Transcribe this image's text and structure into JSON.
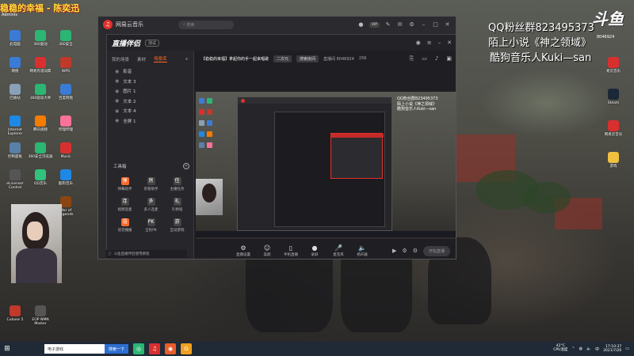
{
  "overlay": {
    "top_left_banner": "稳稳的幸福 - 陈奕迅",
    "admin_label": "Adminis",
    "qq_group": "QQ粉丝群823495373",
    "novel": "陌上小说《神之领域》",
    "kugou_artist": "酷狗音乐人Kuki—san",
    "room_no": "8046924",
    "douyu_logo": "斗鱼"
  },
  "desktop_icons_left": [
    {
      "label": "此电脑",
      "icon": "computer-icon",
      "color": "#3a7bd5"
    },
    {
      "label": "360驱动",
      "icon": "driver-icon",
      "color": "#2bb673"
    },
    {
      "label": "360安全",
      "icon": "shield-icon",
      "color": "#2bb673"
    },
    {
      "label": "网络",
      "icon": "network-icon",
      "color": "#3a7bd5"
    },
    {
      "label": "网易有道词典",
      "icon": "dictionary-icon",
      "color": "#d8302f"
    },
    {
      "label": "WPS",
      "icon": "wps-icon",
      "color": "#c0392b"
    },
    {
      "label": "回收站",
      "icon": "recycle-icon",
      "color": "#8aa0b8"
    },
    {
      "label": "360驱动大师",
      "icon": "driver-master-icon",
      "color": "#2bb673"
    },
    {
      "label": "百度网盘",
      "icon": "cloud-icon",
      "color": "#3a7bd5"
    },
    {
      "label": "Internet Explorer",
      "icon": "ie-icon",
      "color": "#1e88e5"
    },
    {
      "label": "腾讯视频",
      "icon": "video-icon",
      "color": "#f57c00"
    },
    {
      "label": "哔哩哔哩",
      "icon": "bilibili-icon",
      "color": "#fb7299"
    },
    {
      "label": "控制面板",
      "icon": "control-panel-icon",
      "color": "#5a7fa8"
    },
    {
      "label": "360安全浏览器",
      "icon": "browser-icon",
      "color": "#2bb673"
    },
    {
      "label": "Music",
      "icon": "music-icon",
      "color": "#d8302f"
    },
    {
      "label": "eLicenser Control",
      "icon": "elicenser-icon",
      "color": "#555"
    },
    {
      "label": "QQ音乐",
      "icon": "qq-music-icon",
      "color": "#31c27c"
    },
    {
      "label": "酷狗音乐",
      "icon": "kugou-icon",
      "color": "#1e88e5"
    },
    {
      "label": "War of Legends",
      "icon": "game-icon",
      "color": "#8b4513"
    },
    {
      "label": "Cubase 5",
      "icon": "cubase-icon",
      "color": "#c0392b"
    },
    {
      "label": "EOP NMN Master",
      "icon": "eop-icon",
      "color": "#555"
    }
  ],
  "desktop_icons_right": [
    {
      "label": "易云音乐",
      "icon": "netease-music-icon",
      "color": "#d8302f"
    },
    {
      "label": "Steam",
      "icon": "steam-icon",
      "color": "#1b2838"
    },
    {
      "label": "网易云音乐",
      "icon": "netease-icon",
      "color": "#d8302f"
    },
    {
      "label": "游戏",
      "icon": "game-folder-icon",
      "color": "#f0c040"
    }
  ],
  "app": {
    "title": "网易云音乐",
    "search_placeholder": "搜索",
    "user_badge": "VIP",
    "tool": {
      "brand": "直播伴侣",
      "version": "测试",
      "tabs": [
        "我的场景",
        "素材",
        "场景库"
      ],
      "add_tab": "+",
      "scenes": [
        "影音",
        "文本 3",
        "图片 1",
        "文本 2",
        "文本 4",
        "全屏 1"
      ],
      "tools_title": "工具箱",
      "tools": [
        {
          "label": "弹幕助手",
          "glyph": "弹",
          "orange": true
        },
        {
          "label": "房管助手",
          "glyph": "房",
          "orange": false
        },
        {
          "label": "主播任务",
          "glyph": "任",
          "orange": false
        },
        {
          "label": "视频连麦",
          "glyph": "连",
          "orange": false
        },
        {
          "label": "多人连麦",
          "glyph": "多",
          "orange": false
        },
        {
          "label": "礼物墙",
          "glyph": "礼",
          "orange": false
        },
        {
          "label": "语音播报",
          "glyph": "语",
          "orange": true
        },
        {
          "label": "全民PK",
          "glyph": "PK",
          "orange": false
        },
        {
          "label": "互动游戏",
          "glyph": "游",
          "orange": false
        }
      ],
      "footer": "斗鱼直播伴侣使用教程",
      "room_title": "【稳稳的幸福】拿起你的手一起来唱歌",
      "room_category": "二次元",
      "room_chip": "搜索房间",
      "room_stats": "直播间 8046924",
      "room_count": "256",
      "preview_lines": [
        "QQ粉丝群823495373",
        "陌上小说《神之领域》",
        "酷狗音乐人Kuki—san"
      ],
      "controls": [
        {
          "label": "直播设置",
          "icon": "settings-icon",
          "glyph": "⚙"
        },
        {
          "label": "美颜",
          "icon": "beauty-icon",
          "glyph": "☺"
        },
        {
          "label": "手机直播",
          "icon": "phone-icon",
          "glyph": "▯"
        },
        {
          "label": "录屏",
          "icon": "record-icon",
          "glyph": "●"
        },
        {
          "label": "麦克风",
          "icon": "mic-icon",
          "glyph": "🎤"
        },
        {
          "label": "扬声器",
          "icon": "speaker-icon",
          "glyph": "🔈"
        }
      ],
      "start_button": "开始直播",
      "status": [
        "CPU: 6%",
        "码率: 0kb/s",
        "帧率: 0",
        "丢帧: 0",
        "时长: 00:00:00"
      ]
    },
    "ad_bar": "斗鱼直播伴侣使用教程"
  },
  "taskbar": {
    "search_placeholder": "电子游戏",
    "search_button": "搜索一下",
    "weather_temp": "42°C",
    "weather_desc": "CPU温度",
    "time": "17:10:37",
    "date": "2021/7/26",
    "lang": "中"
  }
}
